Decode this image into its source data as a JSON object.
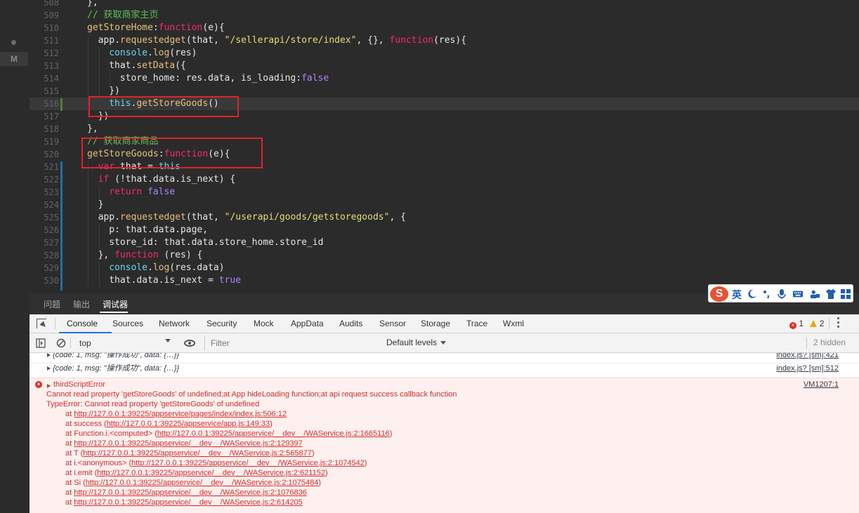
{
  "editor": {
    "gutter_marker": "M",
    "lines": [
      {
        "num": "508",
        "indent": 2,
        "tokens": [
          [
            "pun",
            "},"
          ]
        ]
      },
      {
        "num": "509",
        "indent": 2,
        "tokens": [
          [
            "cm",
            "// 获取商家主页"
          ]
        ]
      },
      {
        "num": "510",
        "indent": 2,
        "tokens": [
          [
            "fn",
            "getStoreHome"
          ],
          [
            "pun",
            ":"
          ],
          [
            "kw",
            "function"
          ],
          [
            "pun",
            "("
          ],
          [
            "prop",
            "e"
          ],
          [
            "pun",
            "){"
          ]
        ]
      },
      {
        "num": "511",
        "indent": 3,
        "tokens": [
          [
            "pun",
            "app."
          ],
          [
            "fn",
            "requestedget"
          ],
          [
            "pun",
            "(that, "
          ],
          [
            "str",
            "\"/sellerapi/store/index\""
          ],
          [
            "pun",
            ", {}, "
          ],
          [
            "kw",
            "function"
          ],
          [
            "pun",
            "(res){"
          ]
        ]
      },
      {
        "num": "512",
        "indent": 4,
        "tokens": [
          [
            "cyan",
            "console"
          ],
          [
            "pun",
            "."
          ],
          [
            "fn",
            "log"
          ],
          [
            "pun",
            "(res)"
          ]
        ]
      },
      {
        "num": "513",
        "indent": 4,
        "tokens": [
          [
            "pun",
            "that."
          ],
          [
            "fn",
            "setData"
          ],
          [
            "pun",
            "({"
          ]
        ]
      },
      {
        "num": "514",
        "indent": 5,
        "tokens": [
          [
            "pun",
            "store_home: res.data, is_loading:"
          ],
          [
            "bool",
            "false"
          ]
        ]
      },
      {
        "num": "515",
        "indent": 4,
        "tokens": [
          [
            "pun",
            "})"
          ]
        ]
      },
      {
        "num": "516",
        "indent": 4,
        "tokens": [
          [
            "cyan",
            "this"
          ],
          [
            "pun",
            "."
          ],
          [
            "fn",
            "getStoreGoods"
          ],
          [
            "pun",
            "()"
          ]
        ]
      },
      {
        "num": "517",
        "indent": 3,
        "tokens": [
          [
            "pun",
            "})"
          ]
        ]
      },
      {
        "num": "518",
        "indent": 2,
        "tokens": [
          [
            "pun",
            "},"
          ]
        ]
      },
      {
        "num": "519",
        "indent": 2,
        "tokens": [
          [
            "cm",
            "// 获取商家商品"
          ]
        ]
      },
      {
        "num": "520",
        "indent": 2,
        "tokens": [
          [
            "fn",
            "getStoreGoods"
          ],
          [
            "pun",
            ":"
          ],
          [
            "kw",
            "function"
          ],
          [
            "pun",
            "("
          ],
          [
            "prop",
            "e"
          ],
          [
            "pun",
            "){"
          ]
        ]
      },
      {
        "num": "521",
        "indent": 3,
        "tokens": [
          [
            "kw",
            "var"
          ],
          [
            "pun",
            " that = "
          ],
          [
            "cyan",
            "this"
          ]
        ]
      },
      {
        "num": "522",
        "indent": 3,
        "tokens": [
          [
            "kw",
            "if"
          ],
          [
            "pun",
            " (!that.data.is_next) {"
          ]
        ]
      },
      {
        "num": "523",
        "indent": 4,
        "tokens": [
          [
            "kw",
            "return"
          ],
          [
            "pun",
            " "
          ],
          [
            "bool",
            "false"
          ]
        ]
      },
      {
        "num": "524",
        "indent": 3,
        "tokens": [
          [
            "pun",
            "}"
          ]
        ]
      },
      {
        "num": "525",
        "indent": 3,
        "tokens": [
          [
            "pun",
            "app."
          ],
          [
            "fn",
            "requestedget"
          ],
          [
            "pun",
            "(that, "
          ],
          [
            "str",
            "\"/userapi/goods/getstoregoods\""
          ],
          [
            "pun",
            ", {"
          ]
        ]
      },
      {
        "num": "526",
        "indent": 4,
        "tokens": [
          [
            "pun",
            "p: that.data.page,"
          ]
        ]
      },
      {
        "num": "527",
        "indent": 4,
        "tokens": [
          [
            "pun",
            "store_id: that.data.store_home.store_id"
          ]
        ]
      },
      {
        "num": "528",
        "indent": 3,
        "tokens": [
          [
            "pun",
            "}, "
          ],
          [
            "kw",
            "function"
          ],
          [
            "pun",
            " (res) {"
          ]
        ]
      },
      {
        "num": "529",
        "indent": 4,
        "tokens": [
          [
            "cyan",
            "console"
          ],
          [
            "pun",
            "."
          ],
          [
            "fn",
            "log"
          ],
          [
            "pun",
            "(res.data)"
          ]
        ]
      },
      {
        "num": "530",
        "indent": 4,
        "tokens": [
          [
            "pun",
            "that.data.is_next = "
          ],
          [
            "bool",
            "true"
          ]
        ]
      }
    ]
  },
  "panel": {
    "tabs": [
      "问题",
      "输出",
      "调试器"
    ],
    "active_tab": "调试器"
  },
  "devtools": {
    "tabs": [
      "Console",
      "Sources",
      "Network",
      "Security",
      "Mock",
      "AppData",
      "Audits",
      "Sensor",
      "Storage",
      "Trace",
      "Wxml"
    ],
    "active_tab": "Console",
    "error_count": "1",
    "warning_count": "2",
    "context": "top",
    "filter_placeholder": "Filter",
    "levels": "Default levels",
    "hidden": "2 hidden"
  },
  "console": {
    "rows": [
      {
        "text": "{code: 1, msg: \"操作成功\", data: {…}}",
        "source": "index.js? [sm]:421"
      },
      {
        "text": "{code: 1, msg: \"操作成功\", data: {…}}",
        "source": "index.js? [sm]:512"
      }
    ],
    "error": {
      "title": "thirdScriptError",
      "source": "VM1207:1",
      "message": "Cannot read property 'getStoreGoods' of undefined;at App hideLoading function;at api request success callback function",
      "type_line": "TypeError: Cannot read property 'getStoreGoods' of undefined",
      "stack": [
        {
          "prefix": "at ",
          "label": "",
          "url": "http://127.0.0.1:39225/appservice/pages/index/index.js:506:12"
        },
        {
          "prefix": "at success (",
          "label": "",
          "url": "http://127.0.0.1:39225/appservice/app.js:149:33",
          "suffix": ")"
        },
        {
          "prefix": "at Function.i.<computed> (",
          "label": "",
          "url": "http://127.0.0.1:39225/appservice/__dev__/WAService.js:2:1665116",
          "suffix": ")"
        },
        {
          "prefix": "at ",
          "label": "",
          "url": "http://127.0.0.1:39225/appservice/__dev__/WAService.js:2:129397"
        },
        {
          "prefix": "at T (",
          "label": "",
          "url": "http://127.0.0.1:39225/appservice/__dev__/WAService.js:2:565877",
          "suffix": ")"
        },
        {
          "prefix": "at i.<anonymous> (",
          "label": "",
          "url": "http://127.0.0.1:39225/appservice/__dev__/WAService.js:2:1074542",
          "suffix": ")"
        },
        {
          "prefix": "at i.emit (",
          "label": "",
          "url": "http://127.0.0.1:39225/appservice/__dev__/WAService.js:2:621152",
          "suffix": ")"
        },
        {
          "prefix": "at Si (",
          "label": "",
          "url": "http://127.0.0.1:39225/appservice/__dev__/WAService.js:2:1075484",
          "suffix": ")"
        },
        {
          "prefix": "at ",
          "label": "",
          "url": "http://127.0.0.1:39225/appservice/__dev__/WAService.js:2:1076836"
        },
        {
          "prefix": "at ",
          "label": "",
          "url": "http://127.0.0.1:39225/appservice/__dev__/WAService.js:2:614205"
        }
      ]
    }
  },
  "ime": {
    "logo": "S",
    "mode": "英",
    "icons": [
      "moon-icon",
      "punctuation-icon",
      "microphone-icon",
      "keyboard-icon",
      "user-icon",
      "shirt-icon",
      "grid-icon"
    ]
  },
  "colors": {
    "highlight_border": "#e1222a",
    "error_text": "#e52e2e",
    "error_background": "#fff0f0",
    "accent": "#1a73e8"
  }
}
